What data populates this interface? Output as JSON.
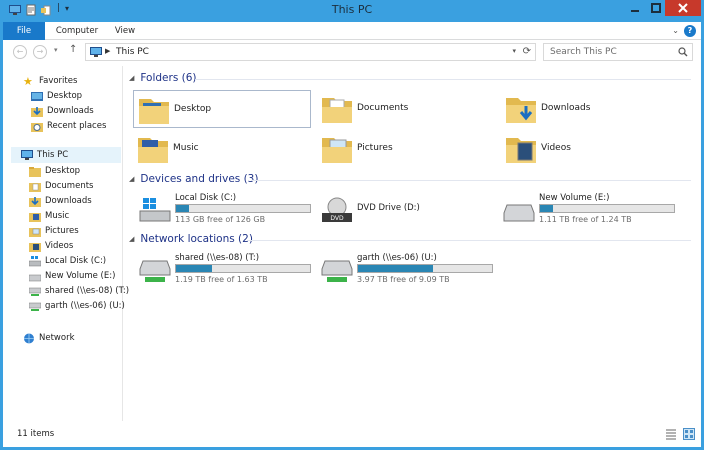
{
  "window": {
    "title": "This PC"
  },
  "ribbon": {
    "tabs": [
      "File",
      "Computer",
      "View"
    ]
  },
  "nav": {
    "address_root": "This PC",
    "search_placeholder": "Search This PC"
  },
  "sidebar": {
    "favorites": {
      "label": "Favorites",
      "items": [
        "Desktop",
        "Downloads",
        "Recent places"
      ]
    },
    "this_pc": {
      "label": "This PC",
      "items": [
        "Desktop",
        "Documents",
        "Downloads",
        "Music",
        "Pictures",
        "Videos",
        "Local Disk (C:)",
        "New Volume (E:)",
        "shared (\\\\es-08) (T:)",
        "garth (\\\\es-06) (U:)"
      ]
    },
    "network": {
      "label": "Network"
    }
  },
  "main": {
    "folders": {
      "header": "Folders (6)",
      "items": [
        "Desktop",
        "Documents",
        "Downloads",
        "Music",
        "Pictures",
        "Videos"
      ]
    },
    "devices": {
      "header": "Devices and drives (3)",
      "items": [
        {
          "name": "Local Disk (C:)",
          "free": "113 GB free of 126 GB",
          "used_fraction": 0.1
        },
        {
          "name": "DVD Drive (D:)"
        },
        {
          "name": "New Volume (E:)",
          "free": "1.11 TB free of 1.24 TB",
          "used_fraction": 0.1
        }
      ]
    },
    "network": {
      "header": "Network locations (2)",
      "items": [
        {
          "name": "shared (\\\\es-08) (T:)",
          "free": "1.19 TB free of 1.63 TB",
          "used_fraction": 0.27
        },
        {
          "name": "garth (\\\\es-06) (U:)",
          "free": "3.97 TB free of 9.09 TB",
          "used_fraction": 0.56
        }
      ]
    }
  },
  "status": {
    "count": "11 items"
  },
  "colors": {
    "accent": "#3aa0e0",
    "file_tab": "#1979ca",
    "bar_fill": "#2a86b4",
    "close": "#c7392b",
    "group_header": "#1e3287"
  }
}
